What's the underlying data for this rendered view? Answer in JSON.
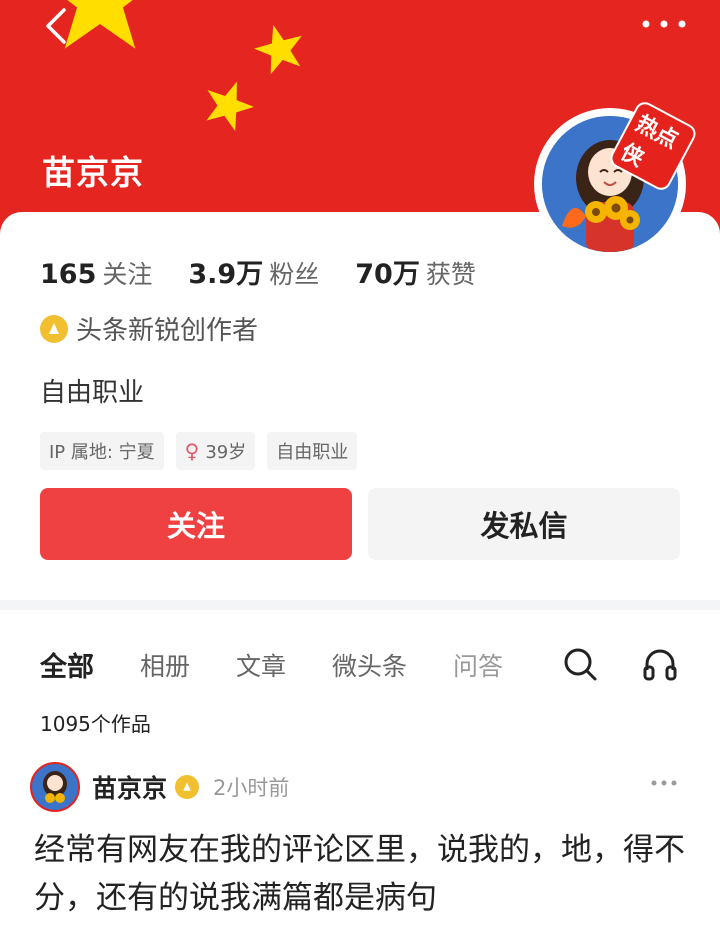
{
  "profile": {
    "name": "苗京京",
    "avatar_badge": "热点侠",
    "stats": [
      {
        "num": "165",
        "label": "关注"
      },
      {
        "num": "3.9万",
        "label": "粉丝"
      },
      {
        "num": "70万",
        "label": "获赞"
      }
    ],
    "creator_title": "头条新锐创作者",
    "bio": "自由职业",
    "tags": {
      "ip": "IP 属地: 宁夏",
      "gender_symbol": "♀",
      "age": "39岁",
      "job": "自由职业"
    },
    "follow_label": "关注",
    "message_label": "发私信"
  },
  "tabs": [
    "全部",
    "相册",
    "文章",
    "微头条",
    "问答"
  ],
  "works_count": "1095个作品",
  "post": {
    "author": "苗京京",
    "time": "2小时前",
    "text": "经常有网友在我的评论区里，说我的，地，得不分，还有的说我满篇都是病句"
  },
  "colors": {
    "banner": "#e52620",
    "star": "#ffde00",
    "follow_button": "#f04142",
    "badge_gold": "#f0c030"
  },
  "icons": [
    "back-icon",
    "more-icon",
    "search-icon",
    "headset-icon",
    "creator-badge-icon"
  ]
}
